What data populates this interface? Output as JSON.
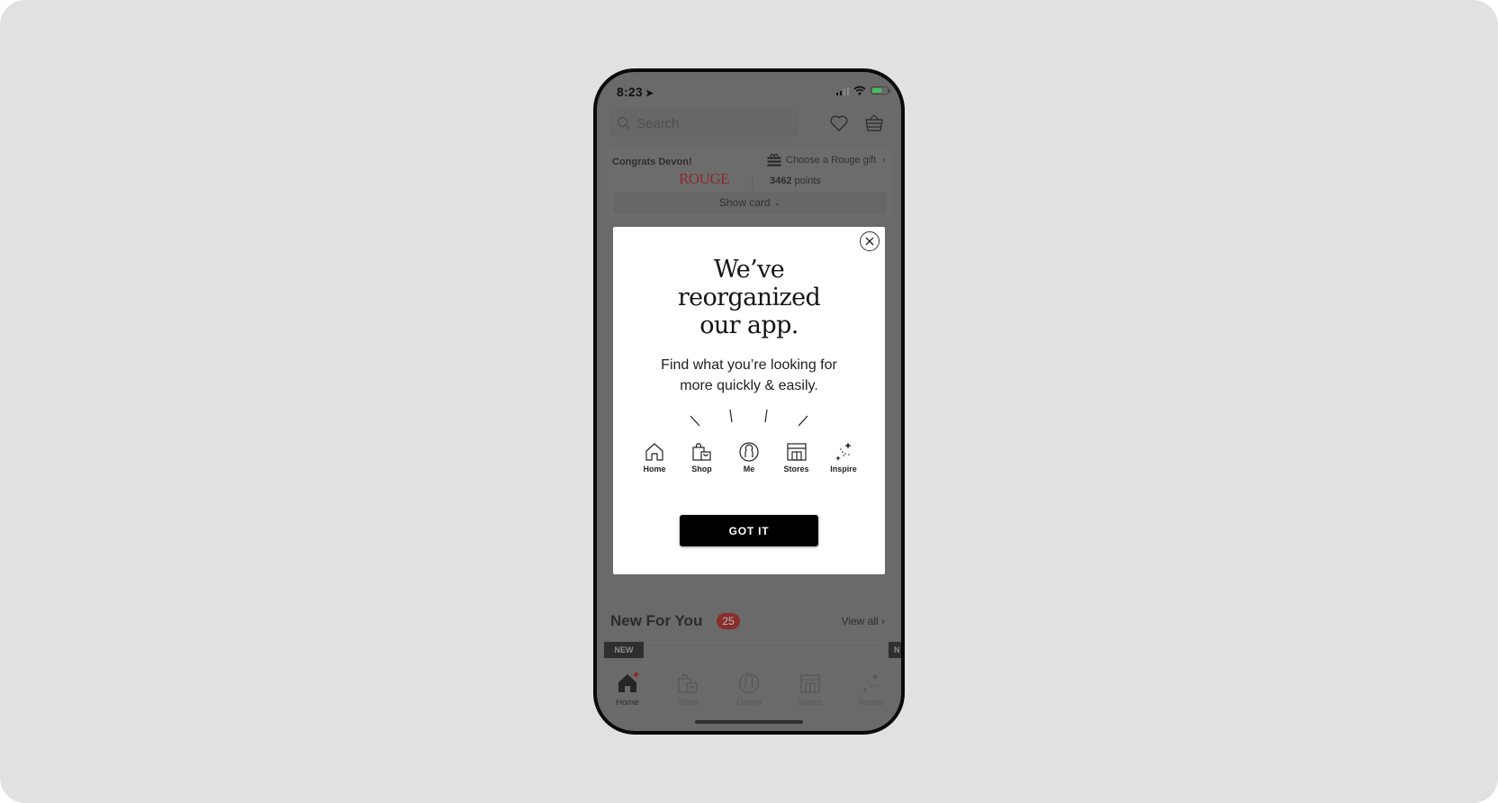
{
  "status_bar": {
    "time": "8:23",
    "location_icon": "location-arrow-icon",
    "battery_color": "#3fc35b"
  },
  "header": {
    "search_placeholder": "Search",
    "icons": [
      "search-icon",
      "heart-icon",
      "basket-icon"
    ]
  },
  "rewards": {
    "greeting": "Congrats Devon!",
    "gift_link": "Choose a Rouge gift",
    "tier_logo": "ROUGE",
    "points_value": "3462",
    "points_label": "points",
    "show_card": "Show card",
    "tier_color": "#8e2a2a"
  },
  "modal": {
    "headline": [
      "We’ve",
      "reorganized",
      "our app."
    ],
    "subtext": [
      "Find what you’re looking for",
      "more quickly & easily."
    ],
    "icons": [
      {
        "label": "Home",
        "icon": "home-icon"
      },
      {
        "label": "Shop",
        "icon": "shopping-bag-icon"
      },
      {
        "label": "Me",
        "icon": "profile-icon"
      },
      {
        "label": "Stores",
        "icon": "store-icon"
      },
      {
        "label": "Inspire",
        "icon": "sparkle-icon"
      }
    ],
    "button_label": "GOT IT"
  },
  "new_for_you": {
    "title": "New For You",
    "count": "25",
    "view_all": "View all",
    "tag": "NEW",
    "tag_partial": "N",
    "badge_color": "#c0403c"
  },
  "tab_bar": {
    "items": [
      {
        "label": "Home",
        "icon": "home-icon",
        "active": true,
        "has_notification_dot": true
      },
      {
        "label": "Shop",
        "icon": "shopping-bag-icon",
        "active": false
      },
      {
        "label": "Devon",
        "icon": "profile-icon",
        "active": false
      },
      {
        "label": "Stores",
        "icon": "store-icon",
        "active": false
      },
      {
        "label": "Inspire",
        "icon": "sparkle-icon",
        "active": false
      }
    ]
  }
}
